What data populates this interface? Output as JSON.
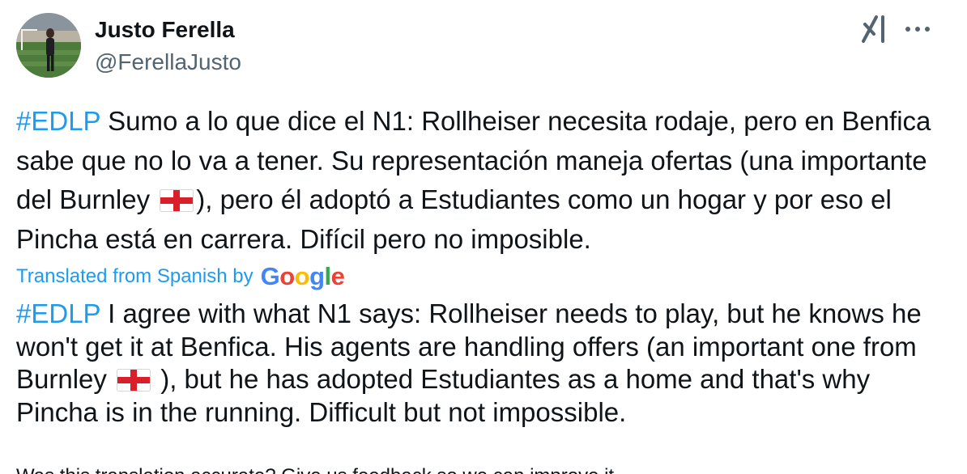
{
  "author": {
    "name": "Justo Ferella",
    "handle": "@FerellaJusto"
  },
  "icons": {
    "avatar": "profile-photo",
    "grok": "grok-icon",
    "more": "more-icon",
    "flag": "england-flag"
  },
  "tweet": {
    "original": {
      "hashtag": "#EDLP",
      "text_before_flag": " Sumo a lo que dice el N1: Rollheiser necesita rodaje, pero en Benfica sabe que no lo va a tener. Su representación maneja ofertas (una importante del Burnley ",
      "text_after_flag": "), pero él adoptó a Estudiantes como un hogar y por eso el Pincha está en carrera. Difícil pero no imposible."
    },
    "translation": {
      "label": "Translated from Spanish by",
      "provider_letters": [
        "G",
        "o",
        "o",
        "g",
        "l",
        "e"
      ],
      "hashtag": "#EDLP",
      "text_before_flag": " I agree with what N1 says: Rollheiser needs to play, but he knows he won't get it at Benfica. His agents are handling offers (an important one from Burnley ",
      "text_after_flag": " ), but he has adopted Estudiantes as a home and that's why Pincha is in the running. Difficult but not impossible."
    },
    "feedback_prompt": "Was this translation accurate? Give us feedback so we can improve it."
  },
  "colors": {
    "link": "#1d9bf0",
    "text": "#0f1419",
    "secondary": "#536471",
    "google_blue": "#4285f4",
    "google_red": "#ea4335",
    "google_yellow": "#fbbc05",
    "google_green": "#34a853"
  }
}
